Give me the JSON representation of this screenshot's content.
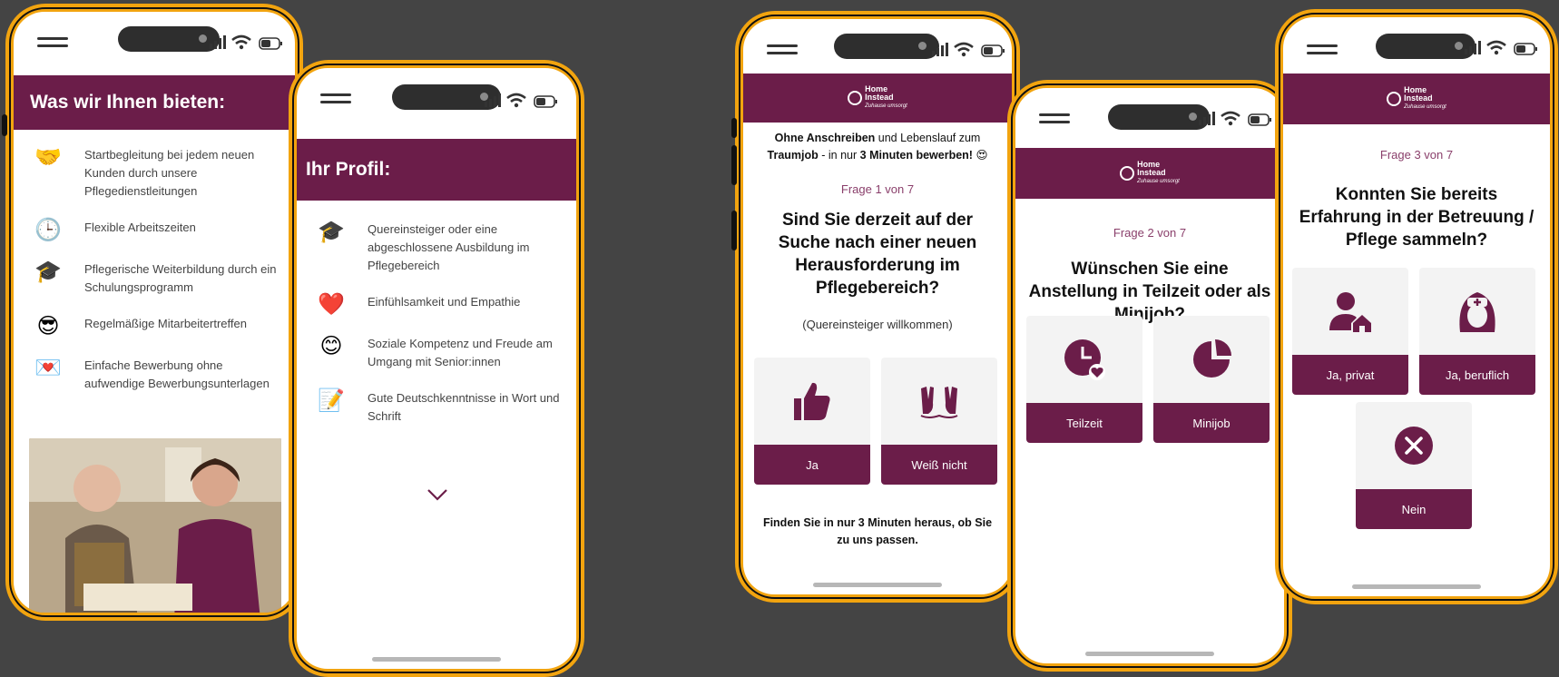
{
  "colors": {
    "frame": "#f2a40f",
    "brand": "#6b1d49",
    "background": "#444444"
  },
  "phone1": {
    "banner": "Was wir Ihnen bieten:",
    "items": [
      {
        "icon": "handshake-icon",
        "glyph": "🤝",
        "text": "Startbegleitung bei jedem neuen Kunden durch unsere Pflegedienstleitungen"
      },
      {
        "icon": "clock-icon",
        "glyph": "🕒",
        "text": "Flexible Arbeitszeiten"
      },
      {
        "icon": "graduation-cap-icon",
        "glyph": "🎓",
        "text": "Pflegerische Weiterbildung durch ein Schulungsprogramm"
      },
      {
        "icon": "sunglasses-face-icon",
        "glyph": "😎",
        "text": "Regelmäßige Mitarbeitertreffen"
      },
      {
        "icon": "love-letter-icon",
        "glyph": "💌",
        "text": "Einfache Bewerbung ohne aufwendige Bewerbungsunterlagen"
      }
    ]
  },
  "phone2": {
    "banner": "Ihr Profil:",
    "items": [
      {
        "icon": "graduation-cap-icon",
        "glyph": "🎓",
        "text": "Quereinsteiger oder eine abgeschlossene Ausbildung im Pflegebereich"
      },
      {
        "icon": "heart-icon",
        "glyph": "❤️",
        "text": "Einfühlsamkeit und Empathie"
      },
      {
        "icon": "smiling-face-icon",
        "glyph": "😊",
        "text": "Soziale Kompetenz und Freude am Umgang mit Senior:innen"
      },
      {
        "icon": "memo-icon",
        "glyph": "📝",
        "text": "Gute Deutschkenntnisse in Wort und Schrift"
      }
    ]
  },
  "logo": {
    "line1": "Home",
    "line2": "Instead",
    "tagline": "Zuhause umsorgt"
  },
  "phone3": {
    "intro": {
      "b1": "Ohne Anschreiben",
      "t1": " und Lebenslauf zum ",
      "b2": "Traumjob",
      "t2": " - in nur ",
      "b3": "3 Minuten bewerben!",
      "emoji": " 😍"
    },
    "qnum": "Frage 1 von 7",
    "title": "Sind Sie derzeit auf der Suche nach einer neuen Herausforderung im Pflegebereich?",
    "sub": "(Quereinsteiger willkommen)",
    "options": [
      "Ja",
      "Weiß nicht"
    ],
    "footer": "Finden Sie in nur 3 Minuten heraus, ob Sie zu uns passen."
  },
  "phone4": {
    "qnum": "Frage 2 von 7",
    "title": "Wünschen Sie eine Anstellung in Teilzeit oder als Minijob?",
    "options": [
      "Teilzeit",
      "Minijob"
    ]
  },
  "phone5": {
    "qnum": "Frage 3 von 7",
    "title": "Konnten Sie bereits Erfahrung in der Betreuung / Pflege sammeln?",
    "options": [
      "Ja, privat",
      "Ja, beruflich",
      "Nein"
    ]
  }
}
